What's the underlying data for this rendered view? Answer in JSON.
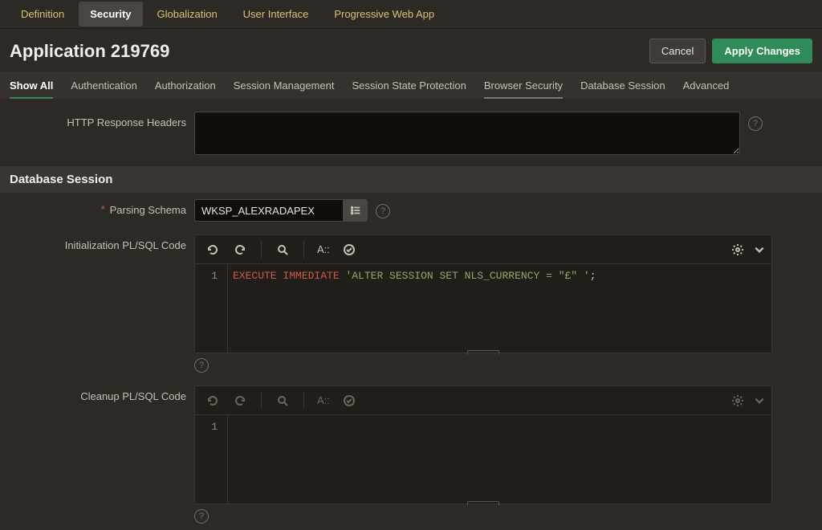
{
  "topTabs": {
    "definition": "Definition",
    "security": "Security",
    "globalization": "Globalization",
    "userInterface": "User Interface",
    "pwa": "Progressive Web App"
  },
  "header": {
    "title": "Application 219769",
    "cancel": "Cancel",
    "apply": "Apply Changes"
  },
  "subTabs": {
    "showAll": "Show All",
    "authentication": "Authentication",
    "authorization": "Authorization",
    "sessionManagement": "Session Management",
    "sessionStateProtection": "Session State Protection",
    "browserSecurity": "Browser Security",
    "databaseSession": "Database Session",
    "advanced": "Advanced"
  },
  "fields": {
    "httpResponseHeaders": "HTTP Response Headers",
    "parsingSchema": "Parsing Schema",
    "initCode": "Initialization PL/SQL Code",
    "cleanupCode": "Cleanup PL/SQL Code"
  },
  "sections": {
    "databaseSession": "Database Session"
  },
  "parsingSchemaValue": "WKSP_ALEXRADAPEX",
  "editor": {
    "init": {
      "lines": [
        {
          "tokens": [
            {
              "kind": "kw",
              "text": "EXECUTE"
            },
            {
              "kind": "plain",
              "text": " "
            },
            {
              "kind": "kw",
              "text": "IMMEDIATE"
            },
            {
              "kind": "plain",
              "text": " "
            },
            {
              "kind": "str",
              "text": "'ALTER SESSION SET NLS_CURRENCY = \"£\" '"
            },
            {
              "kind": "plain",
              "text": ";"
            }
          ]
        }
      ]
    },
    "cleanup": {
      "lines": [
        {
          "tokens": [
            {
              "kind": "plain",
              "text": ""
            }
          ]
        }
      ]
    },
    "toolbar": {
      "textSizeLabel": "A::"
    }
  },
  "icons": {
    "help": "?"
  }
}
